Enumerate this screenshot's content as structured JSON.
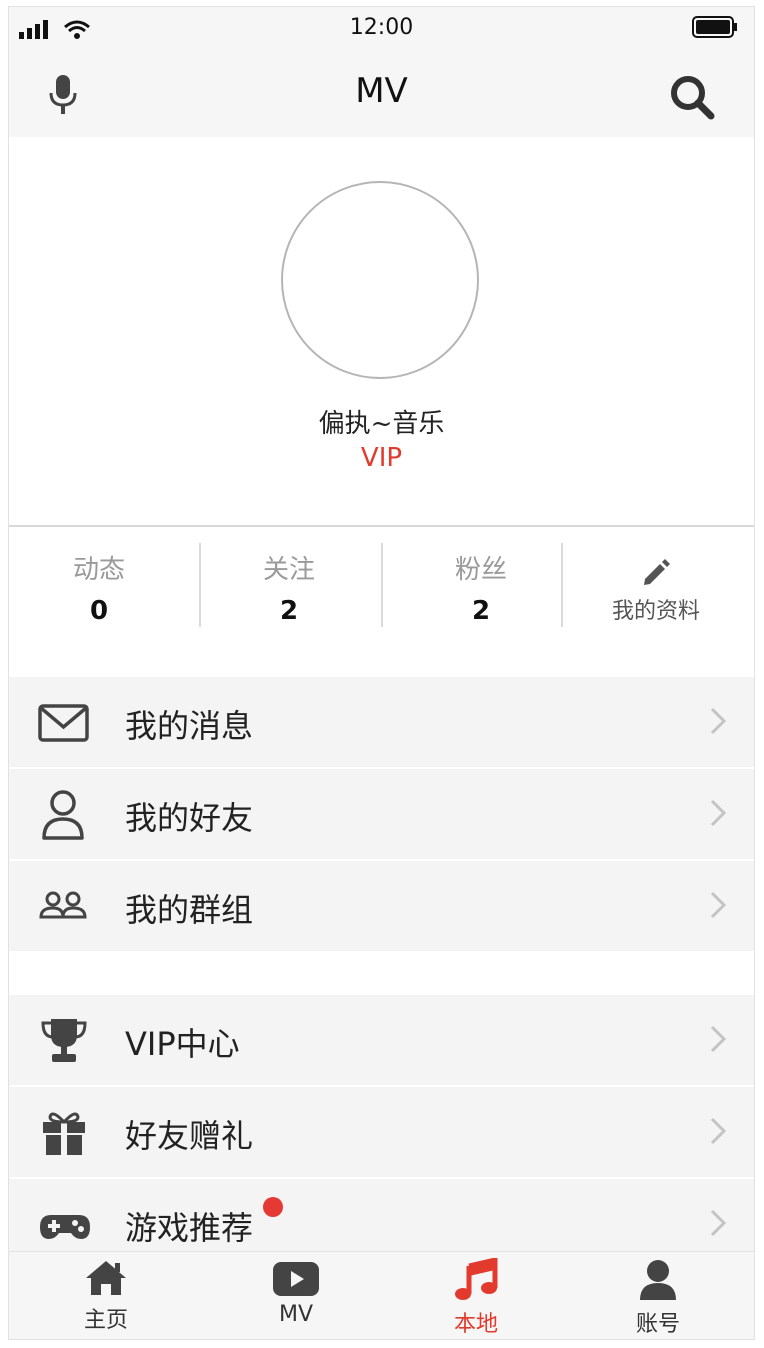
{
  "status_bar": {
    "time": "12:00"
  },
  "nav": {
    "title": "MV"
  },
  "profile": {
    "username": "偏执~音乐",
    "badge": "VIP"
  },
  "stats": [
    {
      "label": "动态",
      "value": "0"
    },
    {
      "label": "关注",
      "value": "2"
    },
    {
      "label": "粉丝",
      "value": "2"
    }
  ],
  "edit_profile": {
    "label": "我的资料"
  },
  "menu_group1": [
    {
      "label": "我的消息",
      "icon": "mail-icon"
    },
    {
      "label": "我的好友",
      "icon": "user-icon"
    },
    {
      "label": "我的群组",
      "icon": "group-icon"
    }
  ],
  "menu_group2": [
    {
      "label": "VIP中心",
      "icon": "trophy-icon"
    },
    {
      "label": "好友赠礼",
      "icon": "gift-icon"
    },
    {
      "label": "游戏推荐",
      "icon": "gamepad-icon",
      "has_notification": true
    }
  ],
  "tabs": [
    {
      "label": "主页",
      "icon": "home-icon"
    },
    {
      "label": "MV",
      "icon": "video-icon"
    },
    {
      "label": "本地",
      "icon": "music-icon",
      "active": true
    },
    {
      "label": "账号",
      "icon": "account-icon"
    }
  ],
  "colors": {
    "accent": "#e23b2e",
    "icon": "#444444",
    "menu_bg": "#f4f4f4"
  }
}
